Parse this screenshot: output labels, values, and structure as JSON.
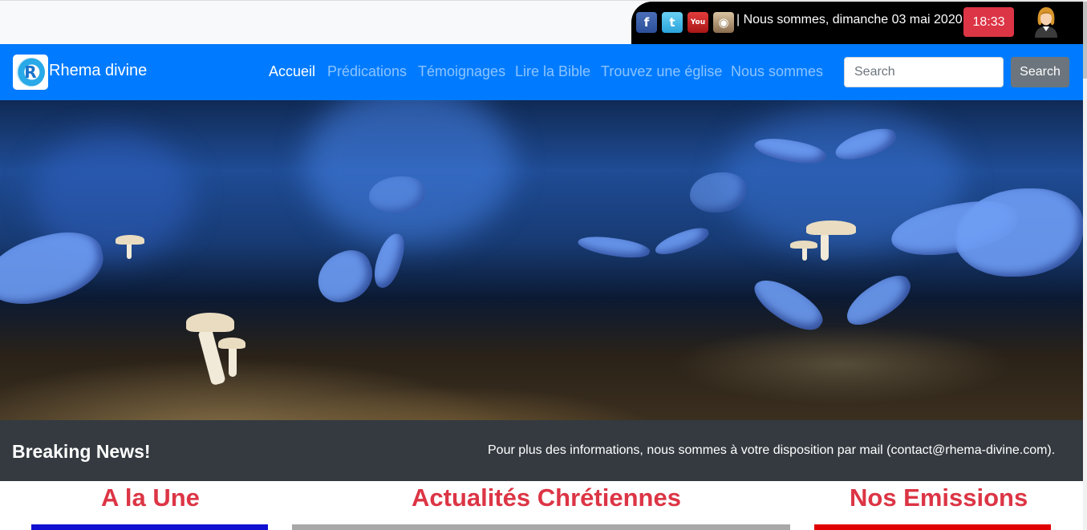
{
  "topbar": {
    "social": [
      {
        "name": "facebook-icon",
        "glyph": "f"
      },
      {
        "name": "twitter-icon",
        "glyph": "t"
      },
      {
        "name": "youtube-icon",
        "glyph": "You"
      },
      {
        "name": "instagram-icon",
        "glyph": "◉"
      }
    ],
    "date_text": "| Nous sommes, dimanche 03 mai 2020",
    "time": "18:33"
  },
  "navbar": {
    "brand_letter": "R",
    "brand_name": "Rhema divine",
    "links": [
      {
        "label": "Accueil",
        "active": true
      },
      {
        "label": "Prédications",
        "active": false
      },
      {
        "label": "Témoignages",
        "active": false
      },
      {
        "label": "Lire la Bible",
        "active": false
      },
      {
        "label": "Trouvez une église",
        "active": false
      },
      {
        "label": "Nous sommes",
        "active": false
      }
    ],
    "search_placeholder": "Search",
    "search_button": "Search"
  },
  "breaking": {
    "title": "Breaking News!",
    "text": "Pour plus des informations, nous sommes à votre disposition par mail (contact@rhema-divine.com)."
  },
  "sections": [
    {
      "title": "A la Une",
      "color": "#1010d0"
    },
    {
      "title": "Actualités Chrétiennes",
      "color": "#a8a8a8"
    },
    {
      "title": "Nos Emissions",
      "color": "#e00000"
    }
  ],
  "colors": {
    "navbar": "#007bff",
    "breaking_bg": "#343a40",
    "section_title": "#dc3545",
    "time_badge": "#dc3545"
  }
}
